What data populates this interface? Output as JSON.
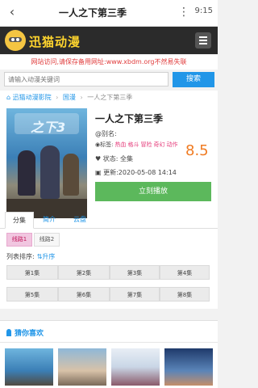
{
  "appbar": {
    "title": "一人之下第三季",
    "time": "9:15"
  },
  "header": {
    "logo_text": "迅猫动漫"
  },
  "notice": "网站访问,请保存备用网址:www.xbdm.org不然易失联",
  "search": {
    "placeholder": "请输入动漫关键词",
    "button": "搜索"
  },
  "breadcrumb": {
    "home": "迅猫动漫影院",
    "category": "国漫",
    "current": "一人之下第三季"
  },
  "poster": {
    "label": "之下3"
  },
  "detail": {
    "name": "一人之下第三季",
    "alias": "@别名:",
    "tags_label": "标签:",
    "tags": [
      "热血",
      "格斗",
      "冒险",
      "奇幻",
      "动作"
    ],
    "score": "8.5",
    "status": "状态: 全集",
    "update": "更新:2020-05-08 14:14",
    "play_button": "立刻播放"
  },
  "tabs": [
    "分集",
    "简介",
    "云盘"
  ],
  "routes": [
    "线路1",
    "线路2"
  ],
  "order": {
    "label": "列表排序:",
    "asc": "升序"
  },
  "episodes": [
    "第1集",
    "第2集",
    "第3集",
    "第4集",
    "第5集",
    "第6集",
    "第7集",
    "第8集"
  ],
  "recommend": {
    "title": "猜你喜欢"
  },
  "colors": {
    "accent": "#2196e8",
    "play": "#5cb85c",
    "score": "#f07b22",
    "notice": "#e03b3b"
  }
}
